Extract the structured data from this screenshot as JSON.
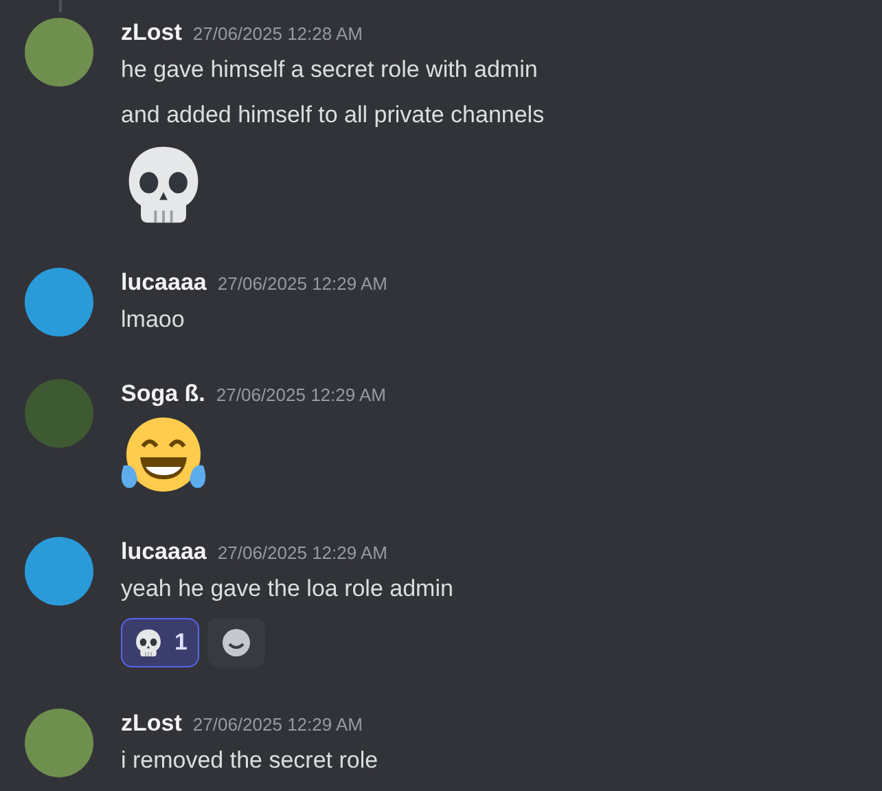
{
  "messages": [
    {
      "author": "zLost",
      "timestamp": "27/06/2025 12:28 AM",
      "color": "#6f8f4e",
      "lines": [
        {
          "kind": "text",
          "text": "he gave himself a secret role with admin"
        },
        {
          "kind": "text",
          "text": "and added himself to all private channels"
        },
        {
          "kind": "skull_emoji"
        }
      ]
    },
    {
      "author": "lucaaaa",
      "timestamp": "27/06/2025 12:29 AM",
      "color": "#2a9bd8",
      "lines": [
        {
          "kind": "text",
          "text": "lmaoo"
        }
      ]
    },
    {
      "author": "Soga ß.",
      "timestamp": "27/06/2025 12:29 AM",
      "color": "#3e5a32",
      "lines": [
        {
          "kind": "laughing_emoji"
        }
      ]
    },
    {
      "author": "lucaaaa",
      "timestamp": "27/06/2025 12:29 AM",
      "color": "#2a9bd8",
      "lines": [
        {
          "kind": "text",
          "text": "yeah he gave the loa role admin"
        }
      ],
      "reactions": [
        {
          "count": "1",
          "selected": true
        }
      ]
    },
    {
      "author": "zLost",
      "timestamp": "27/06/2025 12:29 AM",
      "color": "#6f8f4e",
      "lines": [
        {
          "kind": "text",
          "text": "i removed the secret role"
        }
      ]
    }
  ]
}
